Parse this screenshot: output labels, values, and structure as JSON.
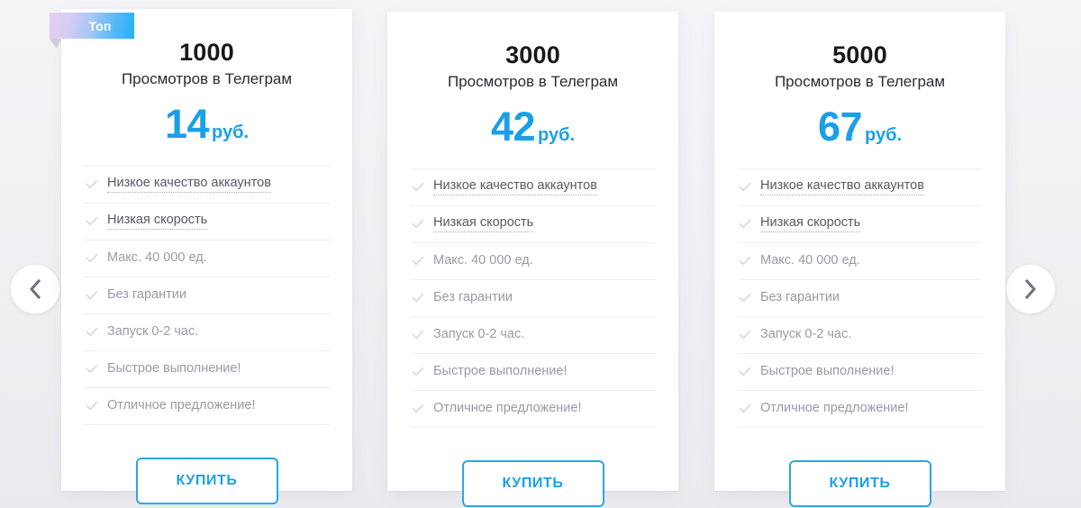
{
  "page": {
    "background_color": "#f1f1f4",
    "accent_color": "#1ba0e8"
  },
  "carousel": {
    "prev": {
      "icon": "chevron-left-icon",
      "label": ""
    },
    "next": {
      "icon": "chevron-right-icon",
      "label": ""
    }
  },
  "badge": {
    "label": "Топ",
    "gradient_from": "#e7cdf0",
    "gradient_to": "#1fb2fb"
  },
  "cards": [
    {
      "quantity": "1000",
      "subtitle": "Просмотров в Телеграм",
      "price": "14",
      "currency": "руб.",
      "badge": true,
      "features": [
        {
          "label": "Низкое качество аккаунтов",
          "hint": true
        },
        {
          "label": "Низкая скорость",
          "hint": true
        },
        {
          "label": "Макс. 40 000 ед.",
          "hint": false
        },
        {
          "label": "Без гарантии",
          "hint": false
        },
        {
          "label": "Запуск 0-2 час.",
          "hint": false
        },
        {
          "label": "Быстрое выполнение!",
          "hint": false
        },
        {
          "label": "Отличное предложение!",
          "hint": false
        }
      ],
      "buy_label": "КУПИТЬ"
    },
    {
      "quantity": "3000",
      "subtitle": "Просмотров в Телеграм",
      "price": "42",
      "currency": "руб.",
      "badge": false,
      "features": [
        {
          "label": "Низкое качество аккаунтов",
          "hint": true
        },
        {
          "label": "Низкая скорость",
          "hint": true
        },
        {
          "label": "Макс. 40 000 ед.",
          "hint": false
        },
        {
          "label": "Без гарантии",
          "hint": false
        },
        {
          "label": "Запуск 0-2 час.",
          "hint": false
        },
        {
          "label": "Быстрое выполнение!",
          "hint": false
        },
        {
          "label": "Отличное предложение!",
          "hint": false
        }
      ],
      "buy_label": "КУПИТЬ"
    },
    {
      "quantity": "5000",
      "subtitle": "Просмотров в Телеграм",
      "price": "67",
      "currency": "руб.",
      "badge": false,
      "features": [
        {
          "label": "Низкое качество аккаунтов",
          "hint": true
        },
        {
          "label": "Низкая скорость",
          "hint": true
        },
        {
          "label": "Макс. 40 000 ед.",
          "hint": false
        },
        {
          "label": "Без гарантии",
          "hint": false
        },
        {
          "label": "Запуск 0-2 час.",
          "hint": false
        },
        {
          "label": "Быстрое выполнение!",
          "hint": false
        },
        {
          "label": "Отличное предложение!",
          "hint": false
        }
      ],
      "buy_label": "КУПИТЬ"
    }
  ]
}
